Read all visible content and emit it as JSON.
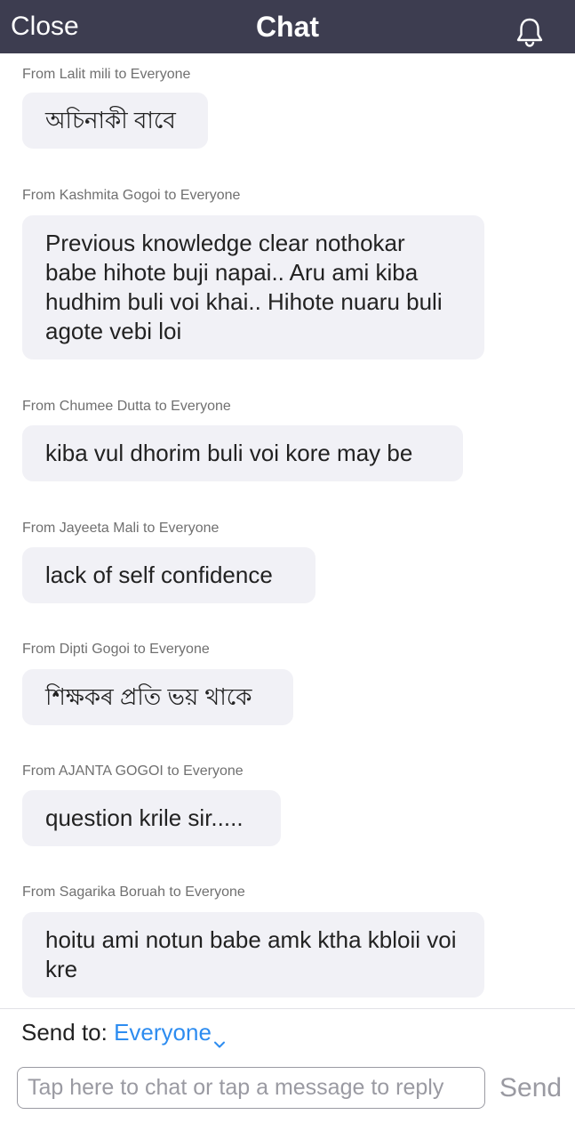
{
  "header": {
    "close_label": "Close",
    "title": "Chat",
    "bell_icon": "bell-icon",
    "background": "#3d3d50"
  },
  "messages": [
    {
      "sender": "From Lalit mili to Everyone",
      "text": "অচিনাকী বাবে"
    },
    {
      "sender": "From Kashmita Gogoi to Everyone",
      "text": "Previous knowledge clear nothokar babe hihote buji napai.. Aru ami kiba hudhim buli voi khai.. Hihote nuaru buli agote vebi loi"
    },
    {
      "sender": "From Chumee Dutta to Everyone",
      "text": "kiba vul dhorim buli voi kore may be"
    },
    {
      "sender": "From Jayeeta Mali to Everyone",
      "text": "lack of self confidence"
    },
    {
      "sender": "From Dipti Gogoi to Everyone",
      "text": "শিক্ষকৰ প্ৰতি ভয় থাকে"
    },
    {
      "sender": "From AJANTA GOGOI to Everyone",
      "text": "question krile sir....."
    },
    {
      "sender": "From Sagarika Boruah to Everyone",
      "text": "hoitu ami notun babe amk ktha kbloii voi kre"
    }
  ],
  "footer": {
    "send_to_label": "Send to:",
    "recipient": "Everyone",
    "recipient_color": "#2d8cf0",
    "chevron_icon": "chevron-down-icon",
    "input_placeholder": "Tap here to chat or tap a message to reply",
    "input_value": "",
    "send_label": "Send"
  }
}
